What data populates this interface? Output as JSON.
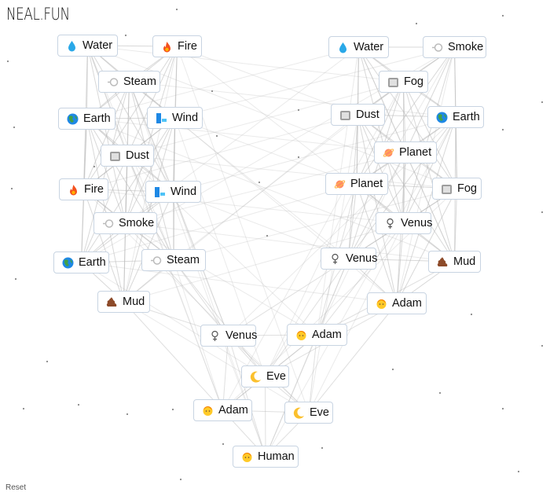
{
  "logo": "NEAL.FUN",
  "reset_label": "Reset",
  "nodes": [
    {
      "label": "Water",
      "icon": "water-drop"
    },
    {
      "label": "Fire",
      "icon": "fire"
    },
    {
      "label": "Steam",
      "icon": "steam"
    },
    {
      "label": "Earth",
      "icon": "earth-globe"
    },
    {
      "label": "Wind",
      "icon": "wind"
    },
    {
      "label": "Dust",
      "icon": "dust"
    },
    {
      "label": "Fire",
      "icon": "fire"
    },
    {
      "label": "Wind",
      "icon": "wind"
    },
    {
      "label": "Smoke",
      "icon": "steam"
    },
    {
      "label": "Earth",
      "icon": "earth-globe"
    },
    {
      "label": "Steam",
      "icon": "steam"
    },
    {
      "label": "Mud",
      "icon": "mud"
    },
    {
      "label": "Venus",
      "icon": "venus-symbol"
    },
    {
      "label": "Adam",
      "icon": "person-face"
    },
    {
      "label": "Eve",
      "icon": "crescent-moon"
    },
    {
      "label": "Adam",
      "icon": "person-face"
    },
    {
      "label": "Eve",
      "icon": "crescent-moon"
    },
    {
      "label": "Human",
      "icon": "person-face"
    },
    {
      "label": "Water",
      "icon": "water-drop"
    },
    {
      "label": "Smoke",
      "icon": "steam"
    },
    {
      "label": "Fog",
      "icon": "dust"
    },
    {
      "label": "Dust",
      "icon": "dust"
    },
    {
      "label": "Earth",
      "icon": "earth-globe"
    },
    {
      "label": "Planet",
      "icon": "planet"
    },
    {
      "label": "Planet",
      "icon": "planet"
    },
    {
      "label": "Fog",
      "icon": "dust"
    },
    {
      "label": "Venus",
      "icon": "venus-symbol"
    },
    {
      "label": "Venus",
      "icon": "venus-symbol"
    },
    {
      "label": "Mud",
      "icon": "mud"
    },
    {
      "label": "Adam",
      "icon": "person-face"
    }
  ]
}
